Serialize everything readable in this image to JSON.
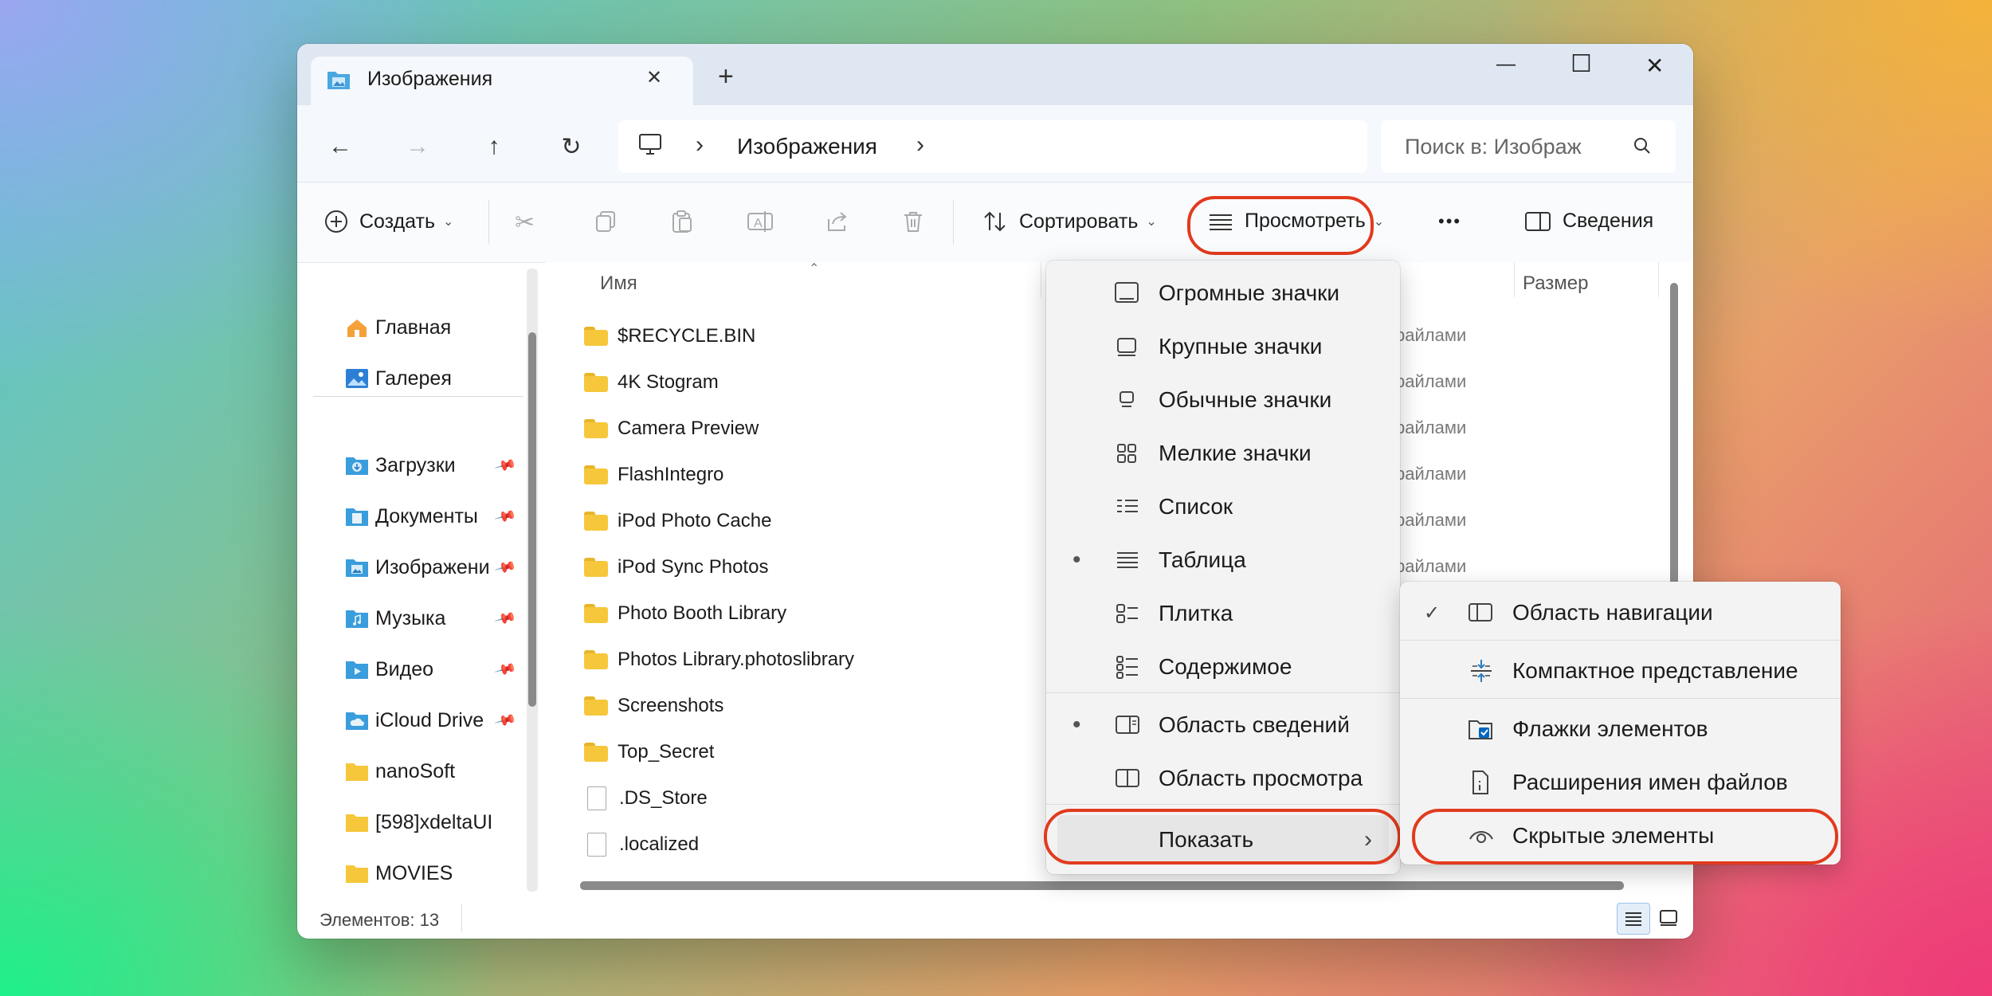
{
  "window": {
    "tab_title": "Изображения",
    "tab_close": "✕",
    "new_tab": "+",
    "minimize": "—",
    "maximize": "☐",
    "close": "✕"
  },
  "nav": {
    "back": "←",
    "forward": "→",
    "up": "↑",
    "refresh": "↻",
    "breadcrumb_sep1": "›",
    "breadcrumb_folder": "Изображения",
    "breadcrumb_sep2": "›",
    "search_placeholder": "Поиск в: Изображ"
  },
  "toolbar": {
    "create": "Создать",
    "sort": "Сортировать",
    "view": "Просмотреть",
    "more": "•••",
    "details": "Сведения"
  },
  "sidebar": {
    "top": [
      {
        "label": "Главная",
        "icon": "home-icon"
      },
      {
        "label": "Галерея",
        "icon": "gallery-icon"
      }
    ],
    "pinned": [
      {
        "label": "Загрузки",
        "icon": "downloads-folder-icon",
        "pinned": true
      },
      {
        "label": "Документы",
        "icon": "documents-folder-icon",
        "pinned": true
      },
      {
        "label": "Изображени",
        "icon": "pictures-folder-icon",
        "pinned": true
      },
      {
        "label": "Музыка",
        "icon": "music-folder-icon",
        "pinned": true
      },
      {
        "label": "Видео",
        "icon": "videos-folder-icon",
        "pinned": true
      },
      {
        "label": "iCloud Drive",
        "icon": "icloud-folder-icon",
        "pinned": true
      },
      {
        "label": "nanoSoft",
        "icon": "folder-icon",
        "pinned": false
      },
      {
        "label": "[598]xdeltaUI",
        "icon": "folder-icon",
        "pinned": false
      },
      {
        "label": "MOVIES",
        "icon": "folder-icon",
        "pinned": false
      }
    ]
  },
  "columns": {
    "name": "Имя",
    "size": "Размер"
  },
  "files": [
    {
      "name": "$RECYCLE.BIN",
      "type": "folder",
      "kind_partial": "райлами"
    },
    {
      "name": "4K Stogram",
      "type": "folder",
      "kind_partial": "райлами"
    },
    {
      "name": "Camera Preview",
      "type": "folder",
      "kind_partial": "райлами"
    },
    {
      "name": "FlashIntegro",
      "type": "folder",
      "kind_partial": "райлами"
    },
    {
      "name": "iPod Photo Cache",
      "type": "folder",
      "kind_partial": "райлами"
    },
    {
      "name": "iPod Sync Photos",
      "type": "folder",
      "kind_partial": "райлами"
    },
    {
      "name": "Photo Booth Library",
      "type": "folder"
    },
    {
      "name": "Photos Library.photoslibrary",
      "type": "folder"
    },
    {
      "name": "Screenshots",
      "type": "folder"
    },
    {
      "name": "Top_Secret",
      "type": "folder"
    },
    {
      "name": ".DS_Store",
      "type": "file"
    },
    {
      "name": ".localized",
      "type": "file"
    }
  ],
  "view_menu": [
    {
      "label": "Огромные значки",
      "icon": "extra-large-icons-icon",
      "bullet": ""
    },
    {
      "label": "Крупные значки",
      "icon": "large-icons-icon",
      "bullet": ""
    },
    {
      "label": "Обычные значки",
      "icon": "medium-icons-icon",
      "bullet": ""
    },
    {
      "label": "Мелкие значки",
      "icon": "small-icons-icon",
      "bullet": ""
    },
    {
      "label": "Список",
      "icon": "list-icon",
      "bullet": ""
    },
    {
      "label": "Таблица",
      "icon": "details-icon",
      "bullet": "•"
    },
    {
      "label": "Плитка",
      "icon": "tiles-icon",
      "bullet": ""
    },
    {
      "label": "Содержимое",
      "icon": "content-icon",
      "bullet": ""
    },
    {
      "label": "Область сведений",
      "icon": "details-pane-icon",
      "bullet": "•"
    },
    {
      "label": "Область просмотра",
      "icon": "preview-pane-icon",
      "bullet": ""
    },
    {
      "label": "Показать",
      "icon": "",
      "bullet": "",
      "submenu": "›"
    }
  ],
  "show_submenu": [
    {
      "label": "Область навигации",
      "icon": "navigation-pane-icon",
      "check": "✓"
    },
    {
      "label": "Компактное представление",
      "icon": "compact-view-icon",
      "check": ""
    },
    {
      "label": "Флажки элементов",
      "icon": "item-checkboxes-icon",
      "check": ""
    },
    {
      "label": "Расширения имен файлов",
      "icon": "file-extensions-icon",
      "check": ""
    },
    {
      "label": "Скрытые элементы",
      "icon": "hidden-items-icon",
      "check": ""
    }
  ],
  "status": {
    "items_count": "Элементов: 13"
  },
  "colors": {
    "highlight_ring": "#e23a1e",
    "accent": "#0067c0",
    "folder": "#f6c73b"
  }
}
